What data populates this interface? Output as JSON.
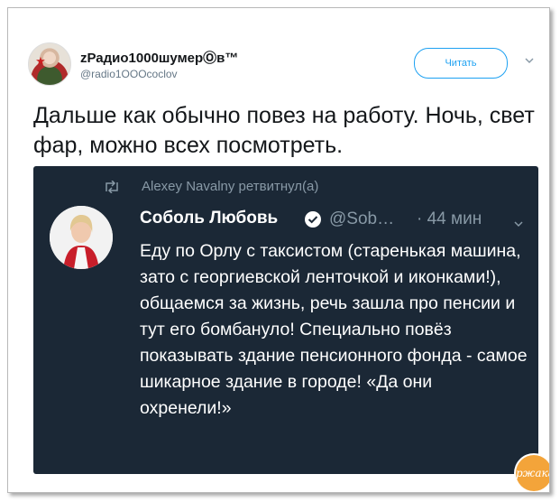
{
  "author": {
    "name": "zРадио1000шумерⓄв™",
    "handle": "@radio1OOOcoclov"
  },
  "follow_label": "Читать",
  "tweet_text": "Дальше как обычно повез на работу. Ночь, свет фар, можно всех посмотреть.",
  "retweet": {
    "line": "Alexey Navalny ретвитнул(а)",
    "author_name": "Соболь Любовь",
    "author_handle": "@Sob…",
    "time": "· 44 мин",
    "text": "Еду по Орлу с таксистом (старенькая машина, зато с георгиевской ленточкой и иконками!), общаемся за жизнь, речь зашла про пенсии и тут его бомбануло! Специально повёз показывать здание пенсионного фонда - самое шикарное здание в городе! «Да они охренели!»"
  },
  "watermark_logo": "Ржака"
}
